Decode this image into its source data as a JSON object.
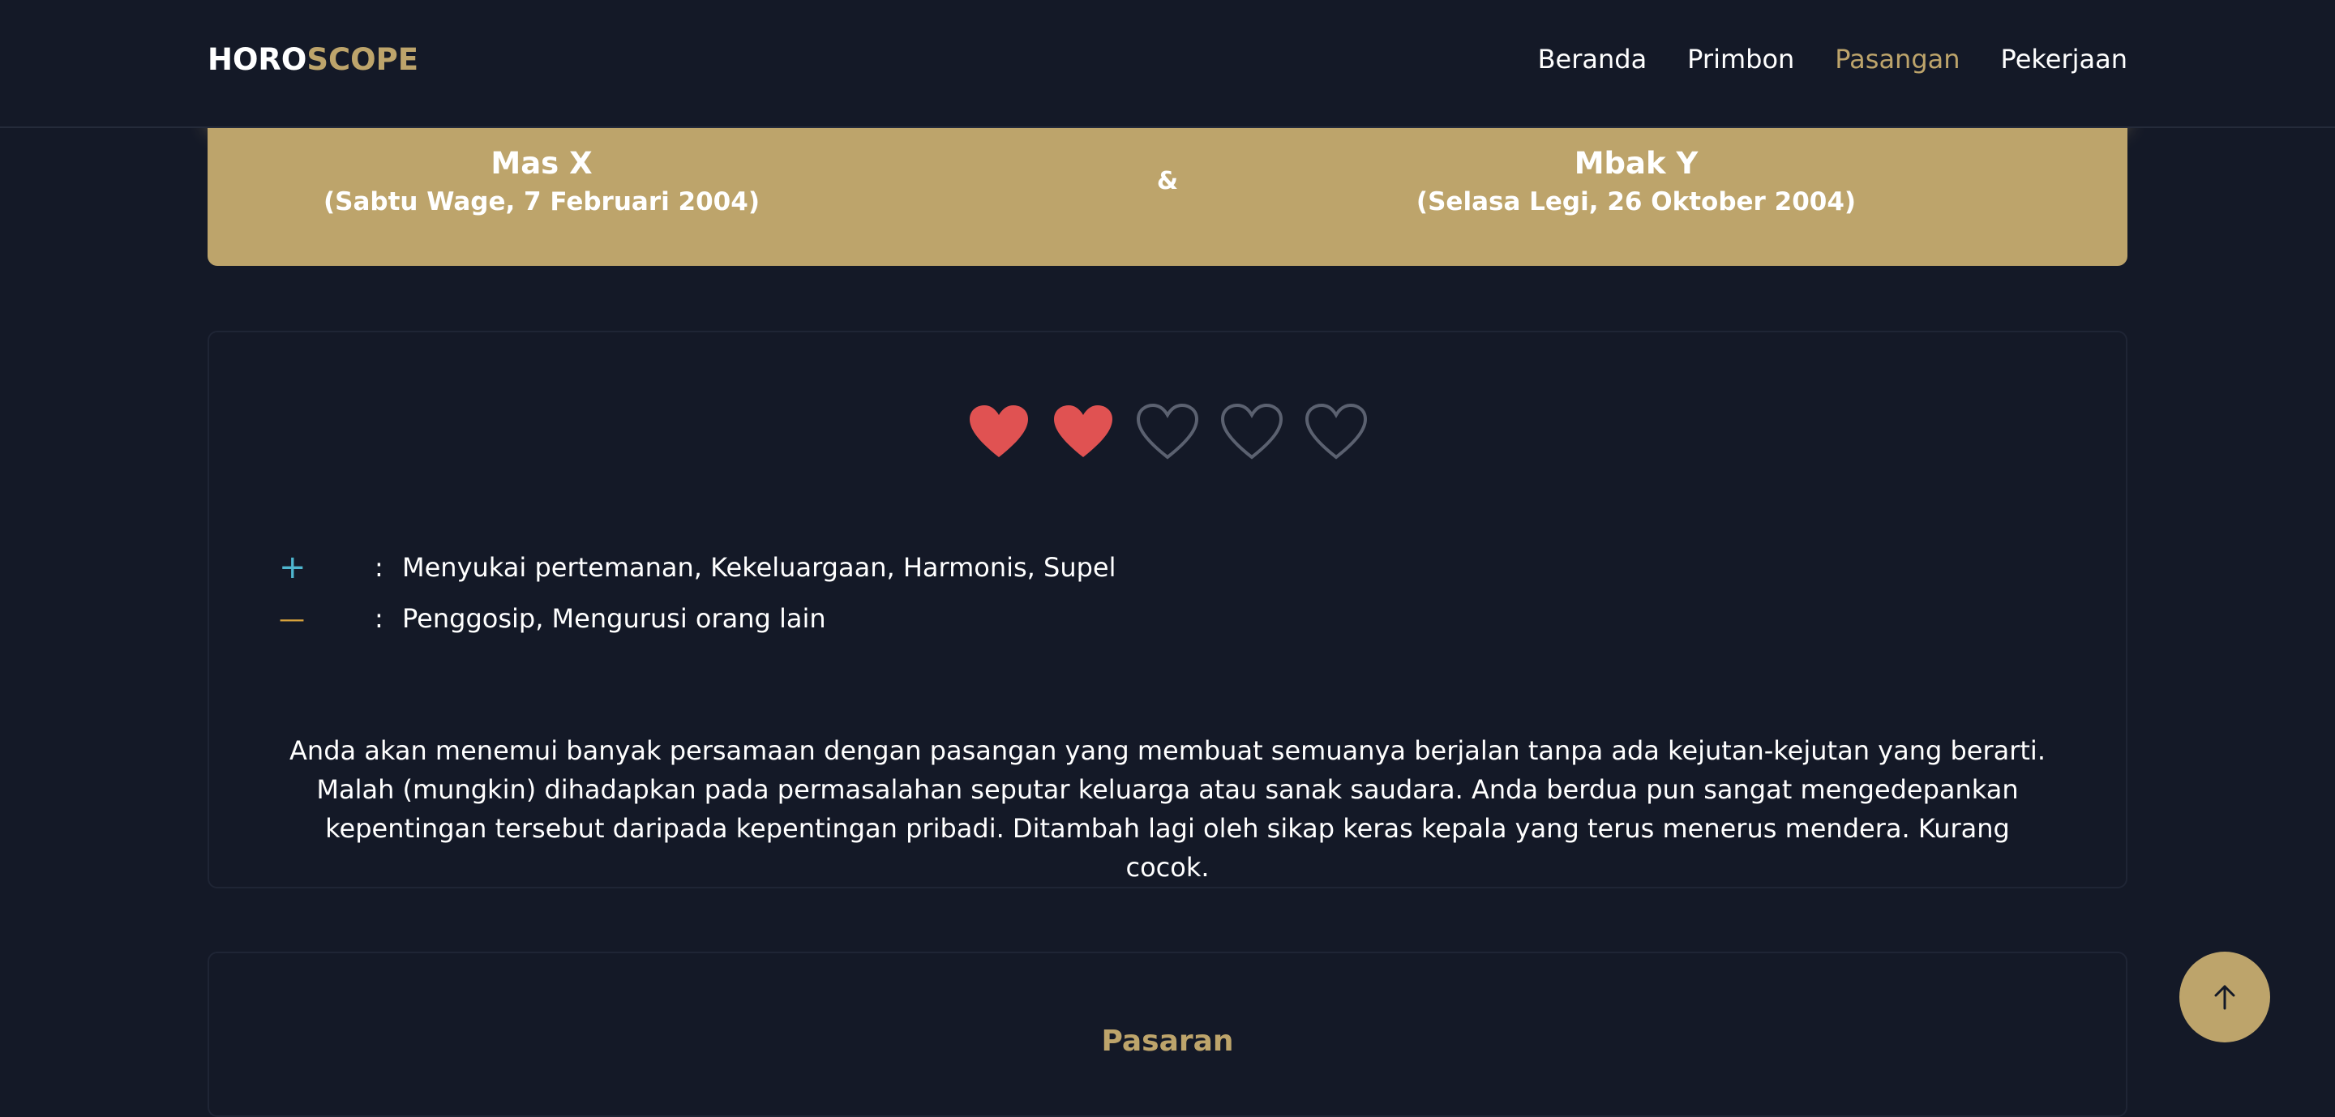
{
  "brand": {
    "part1": "HORO",
    "part2": "SCOPE"
  },
  "nav": {
    "items": [
      {
        "label": "Beranda",
        "active": false
      },
      {
        "label": "Primbon",
        "active": false
      },
      {
        "label": "Pasangan",
        "active": true
      },
      {
        "label": "Pekerjaan",
        "active": false
      }
    ]
  },
  "couple": {
    "left": {
      "name": "Mas X",
      "date": "(Sabtu Wage, 7 Februari 2004)"
    },
    "separator": "&",
    "right": {
      "name": "Mbak Y",
      "date": "(Selasa Legi, 26 Oktober 2004)"
    }
  },
  "result": {
    "rating": 2,
    "rating_max": 5,
    "plus": {
      "symbol": "+",
      "text": "Menyukai pertemanan, Kekeluargaan, Harmonis, Supel"
    },
    "minus": {
      "symbol": "—",
      "text": "Penggosip, Mengurusi orang lain"
    },
    "colon": ":",
    "description": "Anda akan menemui banyak persamaan dengan pasangan yang membuat semuanya berjalan tanpa ada kejutan-kejutan yang berarti. Malah (mungkin) dihadapkan pada permasalahan seputar keluarga atau sanak saudara. Anda berdua pun sangat mengedepankan kepentingan tersebut daripada kepentingan pribadi. Ditambah lagi oleh sikap keras kepala yang terus menerus mendera. Kurang cocok."
  },
  "pasaran": {
    "title": "Pasaran"
  },
  "colors": {
    "gold": "#bda46b",
    "background": "#141927",
    "heart_filled": "#e05252",
    "heart_empty": "#5b6170",
    "plus": "#4fb6cf",
    "minus": "#d8a23c"
  }
}
